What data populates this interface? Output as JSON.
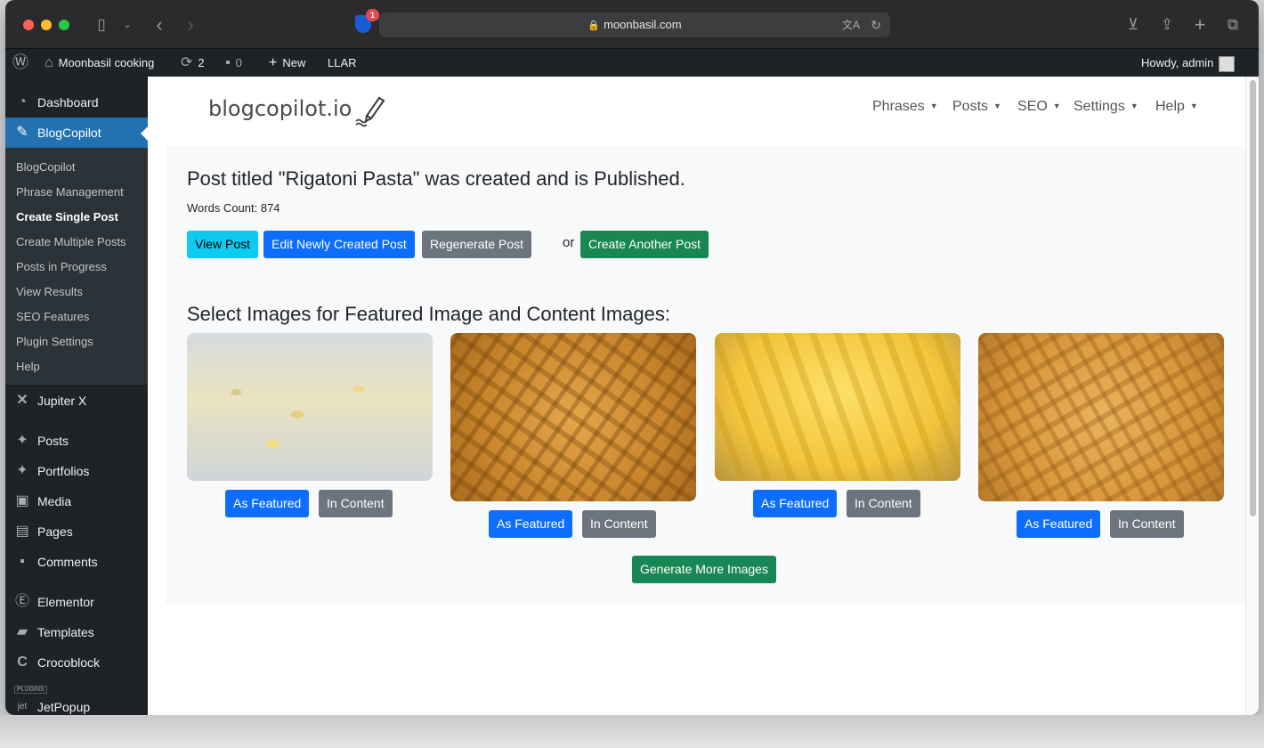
{
  "browser": {
    "url": "moonbasil.com",
    "extension_badge": "1"
  },
  "adminbar": {
    "site_name": "Moonbasil cooking",
    "updates_count": "2",
    "comments_count": "0",
    "new_label": "New",
    "llar_label": "LLAR",
    "greeting": "Howdy, admin"
  },
  "sidebar": {
    "dashboard": "Dashboard",
    "blogcopilot": "BlogCopilot",
    "submenu": [
      "BlogCopilot",
      "Phrase Management",
      "Create Single Post",
      "Create Multiple Posts",
      "Posts in Progress",
      "View Results",
      "SEO Features",
      "Plugin Settings",
      "Help"
    ],
    "jupiterx": "Jupiter X",
    "posts": "Posts",
    "portfolios": "Portfolios",
    "media": "Media",
    "pages": "Pages",
    "comments": "Comments",
    "elementor": "Elementor",
    "templates": "Templates",
    "crocoblock": "Crocoblock",
    "plugins_label": "PLUGINS",
    "jetpopup": "JetPopup"
  },
  "plugin": {
    "logo": "blogcopilot.io",
    "nav": [
      "Phrases",
      "Posts",
      "SEO",
      "Settings",
      "Help"
    ]
  },
  "result": {
    "title": "Post titled \"Rigatoni Pasta\" was created and is Published.",
    "words_count": "Words Count: 874",
    "view_post": "View Post",
    "edit_post": "Edit Newly Created Post",
    "regenerate_post": "Regenerate Post",
    "or": "or",
    "create_another": "Create Another Post"
  },
  "images": {
    "heading": "Select Images for Featured Image and Content Images:",
    "as_featured": "As Featured",
    "in_content": "In Content",
    "generate_more": "Generate More Images"
  },
  "colors": {
    "wp_dark": "#1d2327",
    "wp_blue": "#2271b1",
    "info": "#0dcaf0",
    "primary": "#0d6efd",
    "secondary": "#6c757d",
    "success": "#198754"
  }
}
